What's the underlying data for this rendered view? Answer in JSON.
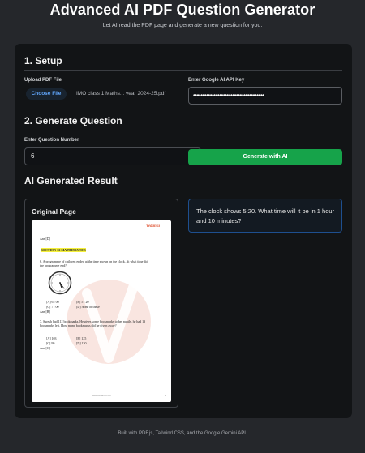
{
  "header": {
    "title": "Advanced AI PDF Question Generator",
    "subtitle": "Let AI read the PDF page and generate a new question for you."
  },
  "setup": {
    "heading": "1. Setup",
    "upload_label": "Upload PDF File",
    "choose_file_label": "Choose File",
    "file_name": "IMO class 1 Maths... year 2024-25.pdf",
    "api_label": "Enter Google AI API Key",
    "api_value": "••••••••••••••••••••••••••••••••••••••"
  },
  "generate": {
    "heading": "2. Generate Question",
    "number_label": "Enter Question Number",
    "number_value": "6",
    "button_label": "Generate with AI"
  },
  "result": {
    "heading": "AI Generated Result",
    "original_title": "Original Page",
    "generated_text": "The clock shows 5:20. What time will it be in 1 hour and 10 minutes?"
  },
  "pdf_page": {
    "logo": "Vedantu",
    "ans_top": "Ans [D]",
    "section": "SECTION-02   MATHEMATICS",
    "q6": "6.   A programme of children ended at the time shown on the clock. At what time did the programme end?",
    "q6_opts_1a": "[A] 6 : 00",
    "q6_opts_1b": "[B] 5 : 20",
    "q6_opts_2a": "[C] 7 : 00",
    "q6_opts_2b": "[D] None of these",
    "q6_ans": "Ans [B]",
    "q7": "7.   Suresh had 112 bookmarks. He gives some bookmarks to her pupils, he had 13 bookmarks left. How many bookmarks did he given away?",
    "q7_opts_1a": "[A] 103",
    "q7_opts_1b": "[B] 125",
    "q7_opts_2a": "[C] 99",
    "q7_opts_2b": "[D] 130",
    "q7_ans": "Ans [C]",
    "footer": "www.vedantu.com",
    "page_number": "3"
  },
  "footer": {
    "text": "Built with PDF.js, Tailwind CSS, and the Google Gemini API."
  },
  "colors": {
    "background": "#25272b",
    "card": "#121416",
    "accent_green": "#16a34a",
    "accent_blue": "#60a5fa",
    "result_border": "#1e4f8f"
  }
}
